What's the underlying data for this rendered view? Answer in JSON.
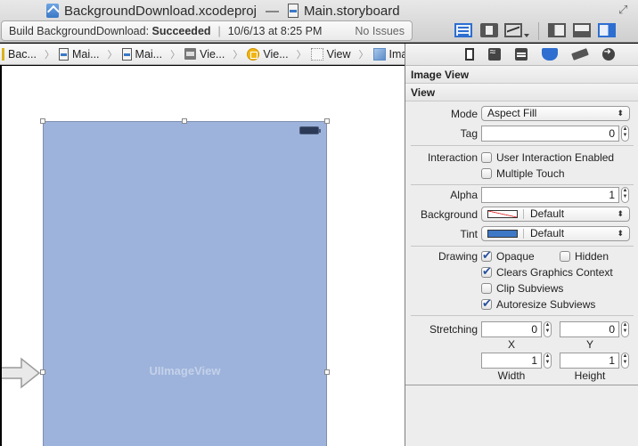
{
  "window": {
    "project_file": "BackgroundDownload.xcodeproj",
    "separator": "—",
    "open_file": "Main.storyboard"
  },
  "activity": {
    "build_prefix": "Build BackgroundDownload:",
    "build_status": "Succeeded",
    "divider": "|",
    "timestamp": "10/6/13 at 8:25 PM",
    "issues": "No Issues"
  },
  "toolbar": {
    "icons": [
      "standard-editor-icon",
      "assistant-editor-icon",
      "version-editor-icon",
      "navigator-toggle-icon",
      "debug-area-toggle-icon",
      "utilities-toggle-icon",
      "fullscreen-icon"
    ],
    "fullscreen_glyph": "⤢"
  },
  "jumpbar": {
    "chevron": "〉",
    "crumbs": [
      {
        "label": "Bac...",
        "icon": "project-icon"
      },
      {
        "label": "Mai...",
        "icon": "storyboard-icon"
      },
      {
        "label": "Mai...",
        "icon": "storyboard-icon"
      },
      {
        "label": "Vie...",
        "icon": "scene-icon"
      },
      {
        "label": "Vie...",
        "icon": "view-controller-icon"
      },
      {
        "label": "View",
        "icon": "view-icon"
      },
      {
        "label": "Image View",
        "icon": "image-view-icon"
      }
    ]
  },
  "canvas": {
    "object_label": "UIImageView",
    "accent_color": "#9db3db"
  },
  "inspector": {
    "tabs": [
      "file-inspector",
      "quick-help-inspector",
      "identity-inspector",
      "attributes-inspector",
      "size-inspector",
      "connections-inspector"
    ],
    "active_tab": "attributes-inspector",
    "section_image_view": "Image View",
    "section_view": "View",
    "mode": {
      "label": "Mode",
      "value": "Aspect Fill"
    },
    "tag": {
      "label": "Tag",
      "value": "0"
    },
    "interaction": {
      "label": "Interaction",
      "user_interaction_enabled": {
        "label": "User Interaction Enabled",
        "checked": false
      },
      "multiple_touch": {
        "label": "Multiple Touch",
        "checked": false
      }
    },
    "alpha": {
      "label": "Alpha",
      "value": "1"
    },
    "background": {
      "label": "Background",
      "value": "Default"
    },
    "tint": {
      "label": "Tint",
      "value": "Default",
      "color": "#3d78c6"
    },
    "drawing": {
      "label": "Drawing",
      "opaque": {
        "label": "Opaque",
        "checked": true
      },
      "hidden": {
        "label": "Hidden",
        "checked": false
      },
      "clears_graphics_context": {
        "label": "Clears Graphics Context",
        "checked": true
      },
      "clip_subviews": {
        "label": "Clip Subviews",
        "checked": false
      },
      "autoresize_subviews": {
        "label": "Autoresize Subviews",
        "checked": true
      }
    },
    "stretching": {
      "label": "Stretching",
      "x": {
        "label": "X",
        "value": "0"
      },
      "y": {
        "label": "Y",
        "value": "0"
      },
      "width": {
        "label": "Width",
        "value": "1"
      },
      "height": {
        "label": "Height",
        "value": "1"
      }
    },
    "popup_arrows": "⬍",
    "stepper_glyph_up": "▲",
    "stepper_glyph_down": "▼"
  }
}
